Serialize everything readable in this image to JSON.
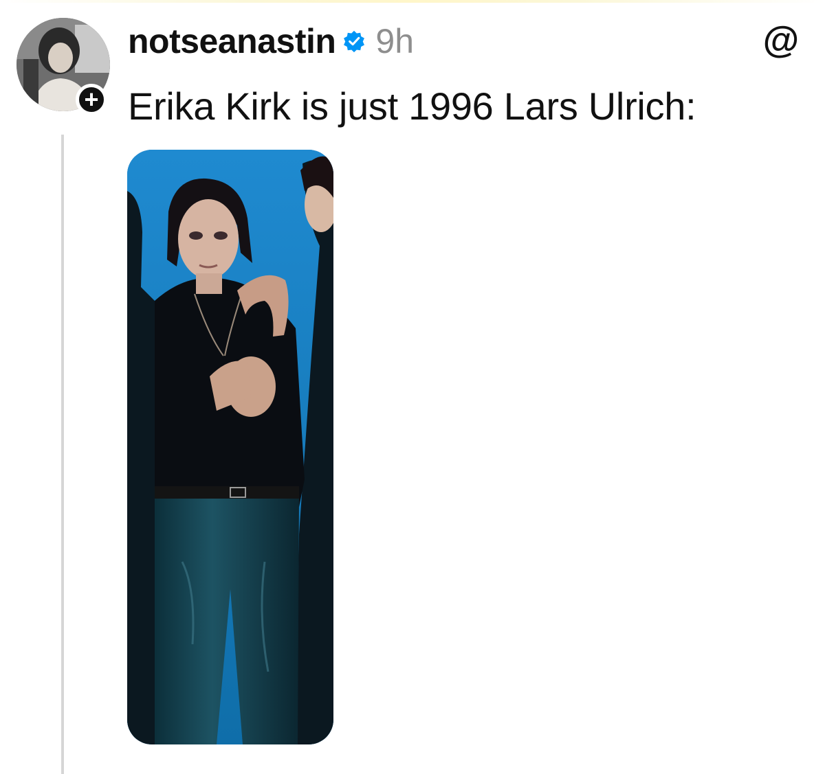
{
  "post": {
    "username": "notseanastin",
    "timestamp": "9h",
    "text": "Erika Kirk is just 1996 Lars Ulrich:",
    "follow_symbol": "+",
    "threads_glyph": "@"
  },
  "icons": {
    "avatar": "profile-photo",
    "verified": "verified-badge-icon",
    "threads": "threads-logo-icon",
    "follow": "plus-icon"
  },
  "colors": {
    "verified_blue": "#0095f6",
    "timestamp_gray": "#8e8e8e",
    "photo_background_blue": "#1a7fc3",
    "text": "#111111"
  }
}
